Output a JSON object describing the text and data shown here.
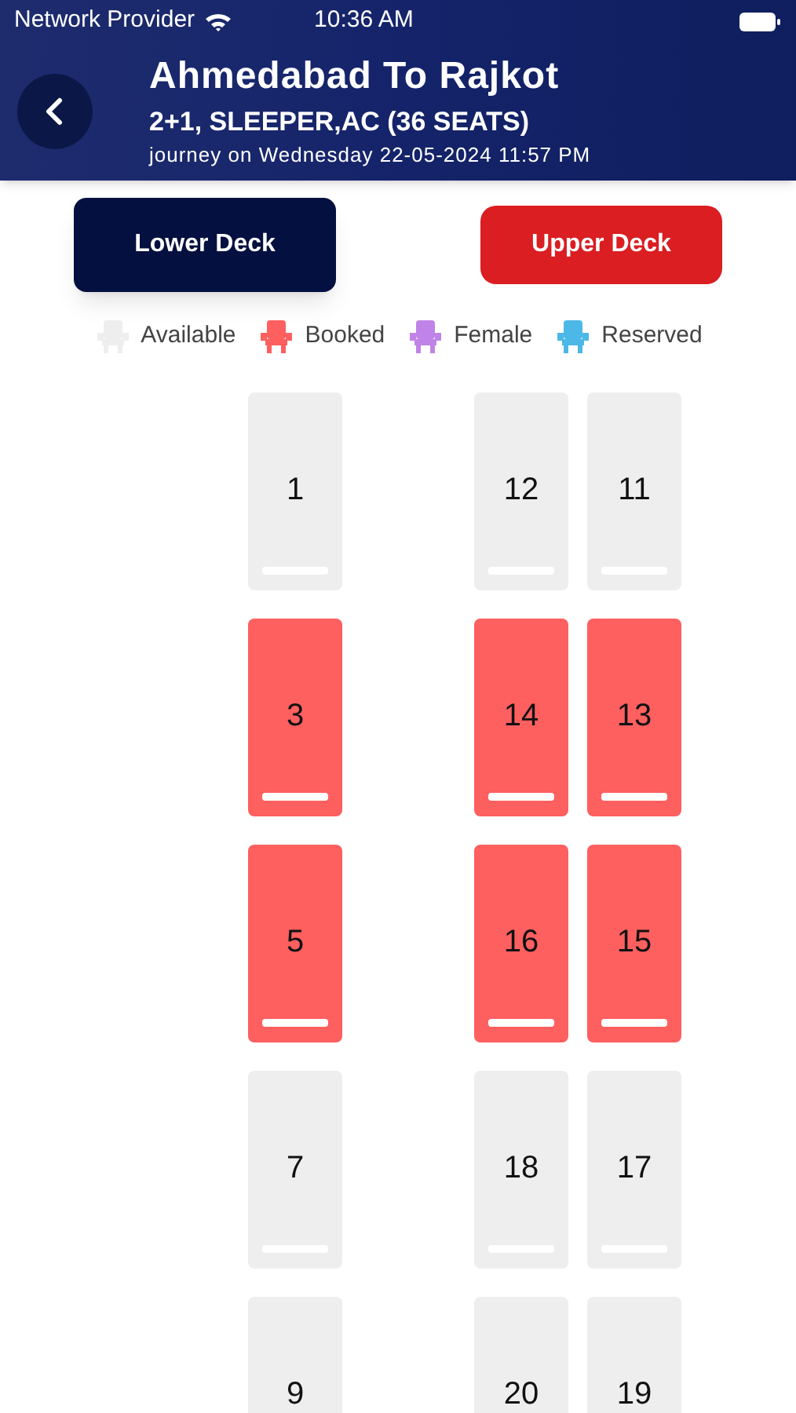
{
  "status_bar": {
    "carrier": "Network Provider",
    "time": "10:36 AM"
  },
  "header": {
    "title": "Ahmedabad To Rajkot",
    "subtitle": "2+1, SLEEPER,AC (36 SEATS)",
    "journey": "journey on Wednesday 22-05-2024 11:57 PM"
  },
  "decks": [
    {
      "label": "Lower Deck",
      "selected": true
    },
    {
      "label": "Upper Deck",
      "selected": false
    }
  ],
  "legend": [
    {
      "label": "Available",
      "color": "#eeeeee"
    },
    {
      "label": "Booked",
      "color": "#fe5f5f"
    },
    {
      "label": "Female",
      "color": "#c084e8"
    },
    {
      "label": "Reserved",
      "color": "#4cb8e8"
    }
  ],
  "rows": [
    {
      "left": {
        "label": "1",
        "booked": false
      },
      "right": [
        {
          "label": "12",
          "booked": false
        },
        {
          "label": "11",
          "booked": false
        }
      ]
    },
    {
      "left": {
        "label": "3",
        "booked": true
      },
      "right": [
        {
          "label": "14",
          "booked": true
        },
        {
          "label": "13",
          "booked": true
        }
      ]
    },
    {
      "left": {
        "label": "5",
        "booked": true
      },
      "right": [
        {
          "label": "16",
          "booked": true
        },
        {
          "label": "15",
          "booked": true
        }
      ]
    },
    {
      "left": {
        "label": "7",
        "booked": false
      },
      "right": [
        {
          "label": "18",
          "booked": false
        },
        {
          "label": "17",
          "booked": false
        }
      ]
    },
    {
      "left": {
        "label": "9",
        "booked": false
      },
      "right": [
        {
          "label": "20",
          "booked": false
        },
        {
          "label": "19",
          "booked": false
        }
      ]
    }
  ]
}
